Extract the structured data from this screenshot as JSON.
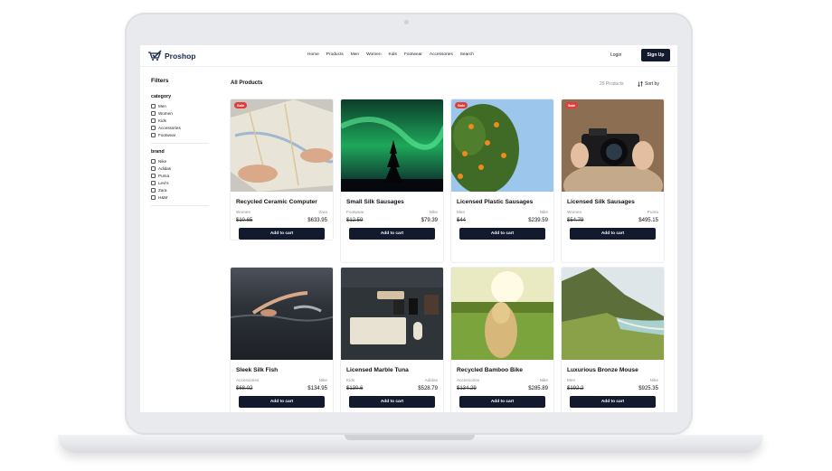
{
  "brand": {
    "name": "Proshop"
  },
  "nav": {
    "items": [
      "Home",
      "Products",
      "Men",
      "Women",
      "Kids",
      "Footwear",
      "Accessories",
      "Search"
    ],
    "login": "Login",
    "signup": "Sign Up"
  },
  "filters": {
    "title": "Filters",
    "category": {
      "title": "category",
      "options": [
        "Men",
        "Women",
        "Kids",
        "Accessories",
        "Footwear"
      ]
    },
    "brand": {
      "title": "brand",
      "options": [
        "Nike",
        "Adidas",
        "Puma",
        "Levi's",
        "Zara",
        "H&M"
      ]
    }
  },
  "listing": {
    "title": "All Products",
    "count": "29 Products",
    "sort_label": "Sort by",
    "add_to_cart": "Add to cart",
    "sale_badge": "Sale"
  },
  "products": [
    {
      "name": "Recycled Ceramic Computer",
      "category": "Women",
      "brand": "Zara",
      "old_price": "$10.65",
      "price": "$633.95",
      "sale": true
    },
    {
      "name": "Small Silk Sausages",
      "category": "Footwear",
      "brand": "Nike",
      "old_price": "$12.59",
      "price": "$79.39",
      "sale": true
    },
    {
      "name": "Licensed Plastic Sausages",
      "category": "Men",
      "brand": "Nike",
      "old_price": "$44",
      "price": "$239.59",
      "sale": true
    },
    {
      "name": "Licensed Silk Sausages",
      "category": "Women",
      "brand": "Puma",
      "old_price": "$54.79",
      "price": "$495.15",
      "sale": true
    },
    {
      "name": "Sleek Silk Fish",
      "category": "Accessories",
      "brand": "Nike",
      "old_price": "$68.02",
      "price": "$134.95",
      "sale": false
    },
    {
      "name": "Licensed Marble Tuna",
      "category": "Kids",
      "brand": "Adidas",
      "old_price": "$130.6",
      "price": "$528.79",
      "sale": false
    },
    {
      "name": "Recycled Bamboo Bike",
      "category": "Accessories",
      "brand": "Nike",
      "old_price": "$134.29",
      "price": "$285.89",
      "sale": false
    },
    {
      "name": "Luxurious Bronze Mouse",
      "category": "Men",
      "brand": "Nike",
      "old_price": "$192.2",
      "price": "$925.35",
      "sale": false
    }
  ],
  "colors": {
    "primary": "#131a2e",
    "sale": "#e23b3b",
    "muted": "#8a8f98",
    "brand_text": "#16284a"
  }
}
